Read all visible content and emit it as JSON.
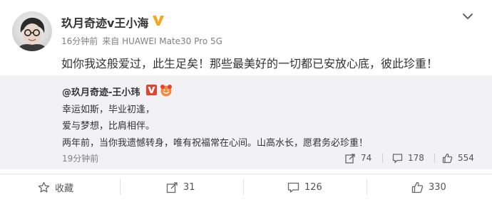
{
  "post": {
    "author": "玖月奇迹v王小海",
    "time": "16分钟前",
    "source": "来自 HUAWEI Mate30 Pro 5G",
    "text": "如你我这般爱过，此生足矣！那些最美好的一切都已安放心底，彼此珍重！",
    "verified_color": "#f5a623"
  },
  "repost": {
    "author": "@玖月奇迹-王小玮",
    "lines": [
      "幸运如斯，毕业初逢，",
      "爱与梦想，比肩相伴。",
      "两年前，当你我遗憾转身，唯有祝福常在心间。山高水长，愿君务必珍重！"
    ],
    "time": "19分钟前",
    "stats": {
      "reposts": "74",
      "comments": "178",
      "likes": "554"
    },
    "background": "#f2f2f5"
  },
  "actions": {
    "favorite": "收藏",
    "repost": "31",
    "comment": "126",
    "like": "330"
  },
  "icons": [
    "more-chevron-icon",
    "verified-v-icon",
    "member-badge-icon",
    "repost-icon",
    "comment-icon",
    "like-icon",
    "star-icon"
  ]
}
